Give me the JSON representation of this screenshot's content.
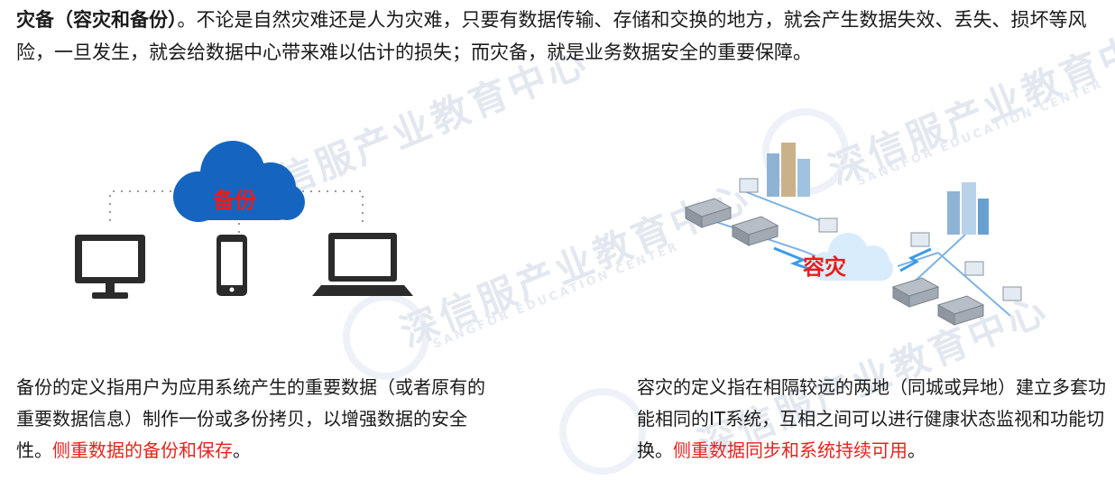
{
  "intro": {
    "term": "灾备（容灾和备份）",
    "body": "。不论是自然灾难还是人为灾难，只要有数据传输、存储和交换的地方，就会产生数据失效、丢失、损坏等风险，一旦发生，就会给数据中心带来难以估计的损失；而灾备，就是业务数据安全的重要保障。"
  },
  "backup": {
    "figure_label": "备份",
    "text": "备份的定义指用户为应用系统产生的重要数据（或者原有的重要数据信息）制作一份或多份拷贝，以增强数据的安全性。",
    "highlight": "侧重数据的备份和保存",
    "end": "。"
  },
  "disaster_recovery": {
    "figure_label": "容灾",
    "text": "容灾的定义指在相隔较远的两地（同城或异地）建立多套功能相同的IT系统，互相之间可以进行健康状态监视和功能切换。",
    "highlight": "侧重数据同步和系统持续可用",
    "end": "。"
  },
  "watermark": {
    "cn": "深信服产业教育中心",
    "en": "SANGFOR EDUCATION CENTER"
  },
  "colors": {
    "highlight": "#e6231e",
    "cloud": "#1565c0",
    "device": "#2b2b2b"
  }
}
